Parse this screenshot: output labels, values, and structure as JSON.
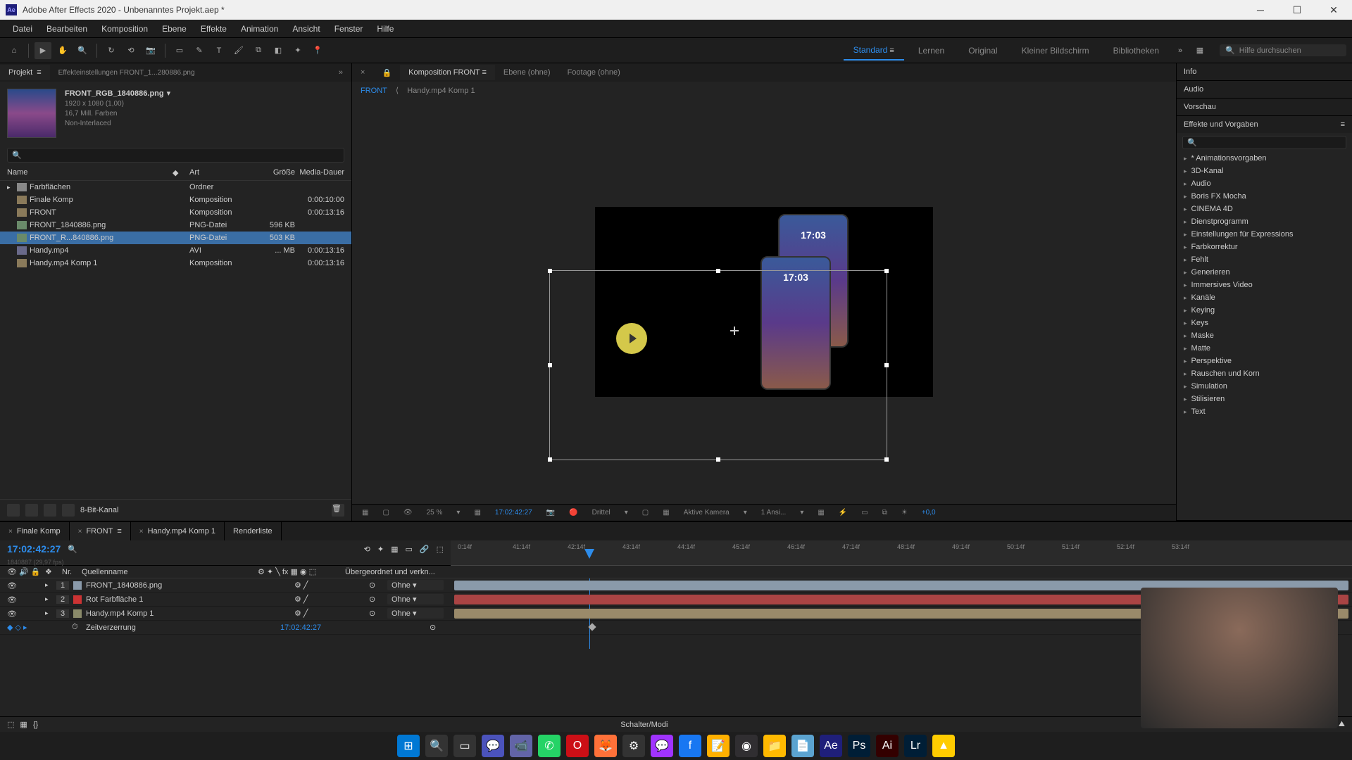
{
  "title_bar": {
    "app_icon": "Ae",
    "title": "Adobe After Effects 2020 - Unbenanntes Projekt.aep *"
  },
  "menu": [
    "Datei",
    "Bearbeiten",
    "Komposition",
    "Ebene",
    "Effekte",
    "Animation",
    "Ansicht",
    "Fenster",
    "Hilfe"
  ],
  "workspaces": {
    "items": [
      "Standard",
      "Lernen",
      "Original",
      "Kleiner Bildschirm",
      "Bibliotheken"
    ],
    "active": "Standard"
  },
  "search_help_placeholder": "Hilfe durchsuchen",
  "project_panel": {
    "tab_project": "Projekt",
    "tab_effect_settings": "Effekteinstellungen  FRONT_1...280886.png",
    "selected_item": {
      "name": "FRONT_RGB_1840886.png",
      "dims": "1920 x 1080 (1,00)",
      "colors": "16,7 Mill. Farben",
      "interlace": "Non-Interlaced"
    },
    "columns": {
      "name": "Name",
      "type": "Art",
      "size": "Größe",
      "dur": "Media-Dauer"
    },
    "rows": [
      {
        "tw": "▸",
        "ico": "folder",
        "name": "Farbflächen",
        "type": "Ordner",
        "size": "",
        "dur": ""
      },
      {
        "tw": "",
        "ico": "comp",
        "name": "Finale Komp",
        "type": "Komposition",
        "size": "",
        "dur": "0:00:10:00"
      },
      {
        "tw": "",
        "ico": "comp",
        "name": "FRONT",
        "type": "Komposition",
        "size": "",
        "dur": "0:00:13:16"
      },
      {
        "tw": "",
        "ico": "png",
        "name": "FRONT_1840886.png",
        "type": "PNG-Datei",
        "size": "596 KB",
        "dur": ""
      },
      {
        "tw": "",
        "ico": "png",
        "name": "FRONT_R...840886.png",
        "type": "PNG-Datei",
        "size": "503 KB",
        "dur": "",
        "selected": true
      },
      {
        "tw": "",
        "ico": "avi",
        "name": "Handy.mp4",
        "type": "AVI",
        "size": "... MB",
        "dur": "0:00:13:16"
      },
      {
        "tw": "",
        "ico": "comp",
        "name": "Handy.mp4 Komp 1",
        "type": "Komposition",
        "size": "",
        "dur": "0:00:13:16"
      }
    ],
    "bit_depth": "8-Bit-Kanal"
  },
  "comp_panel": {
    "tab_comp": "Komposition FRONT",
    "tab_layer": "Ebene  (ohne)",
    "tab_footage": "Footage  (ohne)",
    "crumb_active": "FRONT",
    "crumb_next": "Handy.mp4 Komp 1",
    "phone_time1": "17:03",
    "phone_time2": "17:03",
    "controls": {
      "zoom": "25 %",
      "timecode": "17:02:42:27",
      "res": "Drittel",
      "camera": "Aktive Kamera",
      "views": "1 Ansi...",
      "exposure": "+0,0"
    }
  },
  "right_panels": {
    "info": "Info",
    "audio": "Audio",
    "preview": "Vorschau",
    "effects": "Effekte und Vorgaben",
    "effect_cats": [
      "* Animationsvorgaben",
      "3D-Kanal",
      "Audio",
      "Boris FX Mocha",
      "CINEMA 4D",
      "Dienstprogramm",
      "Einstellungen für Expressions",
      "Farbkorrektur",
      "Fehlt",
      "Generieren",
      "Immersives Video",
      "Kanäle",
      "Keying",
      "Keys",
      "Maske",
      "Matte",
      "Perspektive",
      "Rauschen und Korn",
      "Simulation",
      "Stilisieren",
      "Text"
    ]
  },
  "timeline": {
    "tabs": [
      {
        "name": "Finale Komp",
        "active": false
      },
      {
        "name": "FRONT",
        "active": true
      },
      {
        "name": "Handy.mp4 Komp 1",
        "active": false
      },
      {
        "name": "Renderliste",
        "active": false,
        "nox": true
      }
    ],
    "current_time": "17:02:42:27",
    "frame_info": "1840887 (29,97 fps)",
    "col_nr": "Nr.",
    "col_source": "Quellenname",
    "col_parent": "Übergeordnet und verkn...",
    "ticks": [
      "0:14f",
      "41:14f",
      "42:14f",
      "43:14f",
      "44:14f",
      "45:14f",
      "46:14f",
      "47:14f",
      "48:14f",
      "49:14f",
      "50:14f",
      "51:14f",
      "52:14f",
      "53:14f"
    ],
    "layers": [
      {
        "num": "1",
        "name": "FRONT_1840886.png",
        "color": "#8a9aaa",
        "parent": "Ohne",
        "bar_color": "#8a9aaa"
      },
      {
        "num": "2",
        "name": "Rot Farbfläche 1",
        "color": "#cc3333",
        "parent": "Ohne",
        "bar_color": "#aa4444"
      },
      {
        "num": "3",
        "name": "Handy.mp4 Komp 1",
        "color": "#8a8a6a",
        "parent": "Ohne",
        "bar_color": "#9a8a6a"
      }
    ],
    "prop_label": "Zeitverzerrung",
    "prop_value": "17:02:42:27",
    "bottom_label": "Schalter/Modi"
  },
  "taskbar_icons": [
    {
      "name": "start",
      "glyph": "⊞",
      "bg": "#0078d4"
    },
    {
      "name": "search",
      "glyph": "🔍",
      "bg": "#333"
    },
    {
      "name": "taskview",
      "glyph": "▭",
      "bg": "#333"
    },
    {
      "name": "teams",
      "glyph": "💬",
      "bg": "#4b53bc"
    },
    {
      "name": "meet",
      "glyph": "📹",
      "bg": "#6264a7"
    },
    {
      "name": "whatsapp",
      "glyph": "✆",
      "bg": "#25d366"
    },
    {
      "name": "opera",
      "glyph": "O",
      "bg": "#cc0f16"
    },
    {
      "name": "firefox",
      "glyph": "🦊",
      "bg": "#ff7139"
    },
    {
      "name": "app1",
      "glyph": "⚙",
      "bg": "#333"
    },
    {
      "name": "messenger",
      "glyph": "💬",
      "bg": "#a033ff"
    },
    {
      "name": "facebook",
      "glyph": "f",
      "bg": "#1877f2"
    },
    {
      "name": "notes",
      "glyph": "📝",
      "bg": "#ffb000"
    },
    {
      "name": "obs",
      "glyph": "◉",
      "bg": "#302e31"
    },
    {
      "name": "explorer",
      "glyph": "📁",
      "bg": "#ffb900"
    },
    {
      "name": "notepad",
      "glyph": "📄",
      "bg": "#5ba3d0"
    },
    {
      "name": "ae",
      "glyph": "Ae",
      "bg": "#1f1f7a"
    },
    {
      "name": "ps",
      "glyph": "Ps",
      "bg": "#001e36"
    },
    {
      "name": "ai",
      "glyph": "Ai",
      "bg": "#330000"
    },
    {
      "name": "lr",
      "glyph": "Lr",
      "bg": "#001e36"
    },
    {
      "name": "app2",
      "glyph": "▲",
      "bg": "#ffcc00"
    }
  ]
}
